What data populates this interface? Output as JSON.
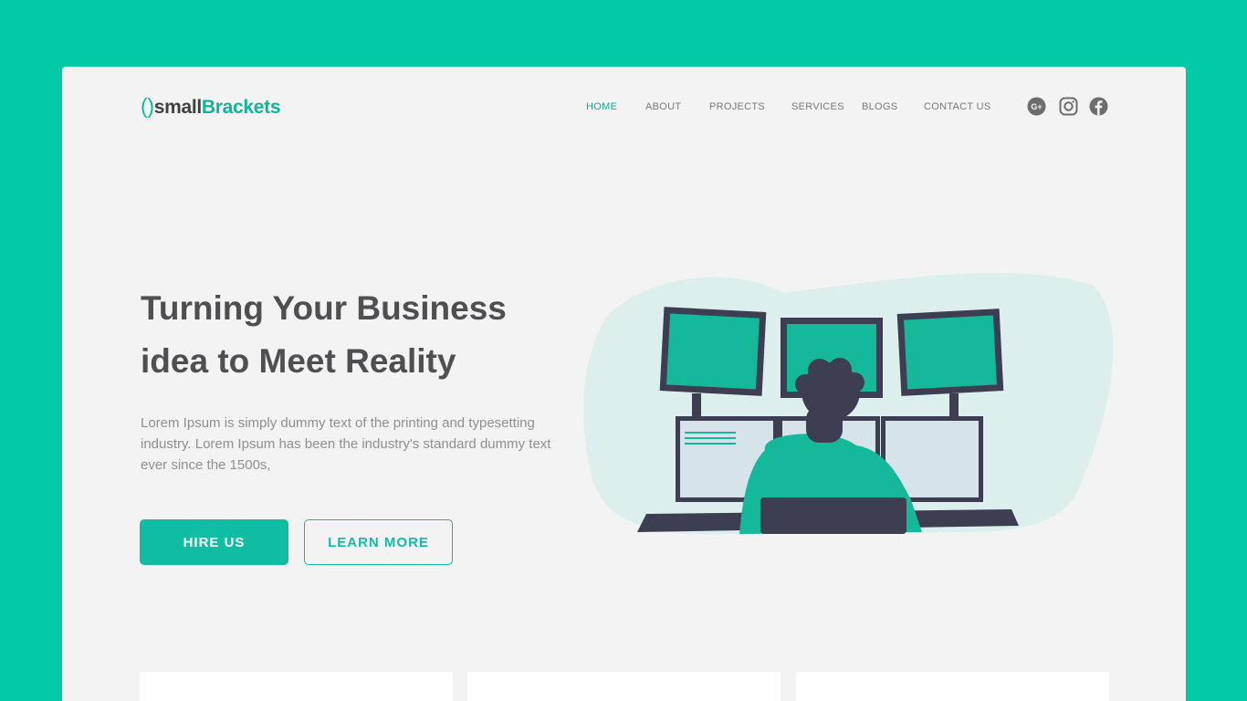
{
  "brand": {
    "open": "()",
    "part1": "small",
    "part2": "Brackets"
  },
  "nav": {
    "items": [
      {
        "label": "HOME",
        "active": true
      },
      {
        "label": "ABOUT"
      },
      {
        "label": "PROJECTS"
      },
      {
        "label": "SERVICES"
      },
      {
        "label": "BLOGS"
      },
      {
        "label": "CONTACT US"
      }
    ]
  },
  "social": [
    "google-plus-icon",
    "instagram-icon",
    "facebook-icon"
  ],
  "hero": {
    "headline": "Turning Your Business idea to Meet Reality",
    "description": "Lorem Ipsum is simply dummy text of the printing and typesetting industry. Lorem Ipsum has been the industry's standard dummy text ever since the 1500s,",
    "hire_label": "HIRE US",
    "learn_label": "LEARN MORE"
  },
  "colors": {
    "outer_bg": "#02c9a6",
    "page_bg": "#f3f3f3",
    "accent": "#10bca2",
    "heading": "#4f4f52",
    "text": "#8f8f8f"
  }
}
